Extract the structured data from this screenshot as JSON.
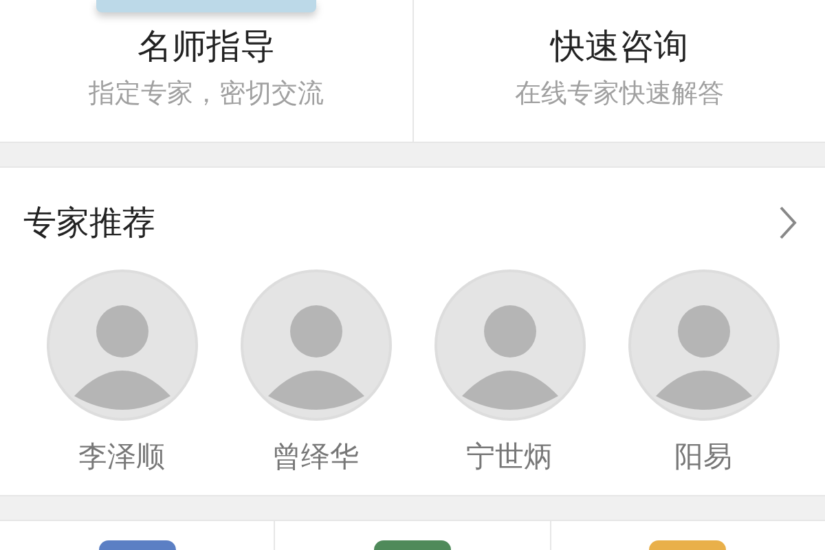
{
  "services": [
    {
      "title": "名师指导",
      "subtitle": "指定专家，密切交流",
      "has_image": true
    },
    {
      "title": "快速咨询",
      "subtitle": "在线专家快速解答",
      "has_image": false
    }
  ],
  "experts": {
    "title": "专家推荐",
    "items": [
      {
        "name": "李泽顺"
      },
      {
        "name": "曾绎华"
      },
      {
        "name": "宁世炳"
      },
      {
        "name": "阳易"
      }
    ]
  },
  "categories": [
    {
      "color": "#5b7fc4"
    },
    {
      "color": "#4f8a5a"
    },
    {
      "color": "#e9b04a"
    }
  ]
}
